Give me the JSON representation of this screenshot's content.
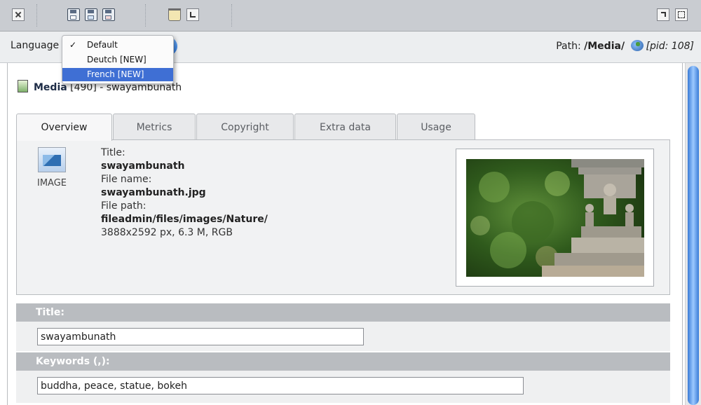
{
  "toolbar": {
    "icons": [
      "close-icon",
      "save-icon",
      "save-view-icon",
      "save-close-icon",
      "delete-icon",
      "undo-icon",
      "open-new-window-icon",
      "fullscreen-icon"
    ]
  },
  "language_bar": {
    "label": "Language",
    "menu": [
      {
        "label": "Default",
        "checked": true
      },
      {
        "label": "Deutch [NEW]",
        "checked": false
      },
      {
        "label": "French [NEW]",
        "checked": false,
        "highlighted": true
      }
    ],
    "check_mark": "✓",
    "path_label": "Path:",
    "path_value": "/Media/",
    "pid": "[pid: 108]"
  },
  "record": {
    "title_bold": "Media",
    "uid": "[490]",
    "sep": "-",
    "name": "swayambunath"
  },
  "tabs": [
    "Overview",
    "Metrics",
    "Copyright",
    "Extra data",
    "Usage"
  ],
  "overview": {
    "type_label": "IMAGE",
    "title_label": "Title:",
    "title_value": "swayambunath",
    "filename_label": "File name:",
    "filename_value": "swayambunath.jpg",
    "filepath_label": "File path:",
    "filepath_value": "fileadmin/files/images/Nature/",
    "info": "3888x2592 px, 6.3 M, RGB"
  },
  "form": {
    "title_label": "Title:",
    "title_value": "swayambunath",
    "keywords_label": "Keywords (,):",
    "keywords_value": "buddha, peace, statue, bokeh"
  },
  "colors": {
    "toolbar_bg": "#c9ccd1",
    "menu_highlight": "#3f6fd4",
    "scroll_accent": "#3a7bd6",
    "field_header": "#b9bcc0"
  }
}
